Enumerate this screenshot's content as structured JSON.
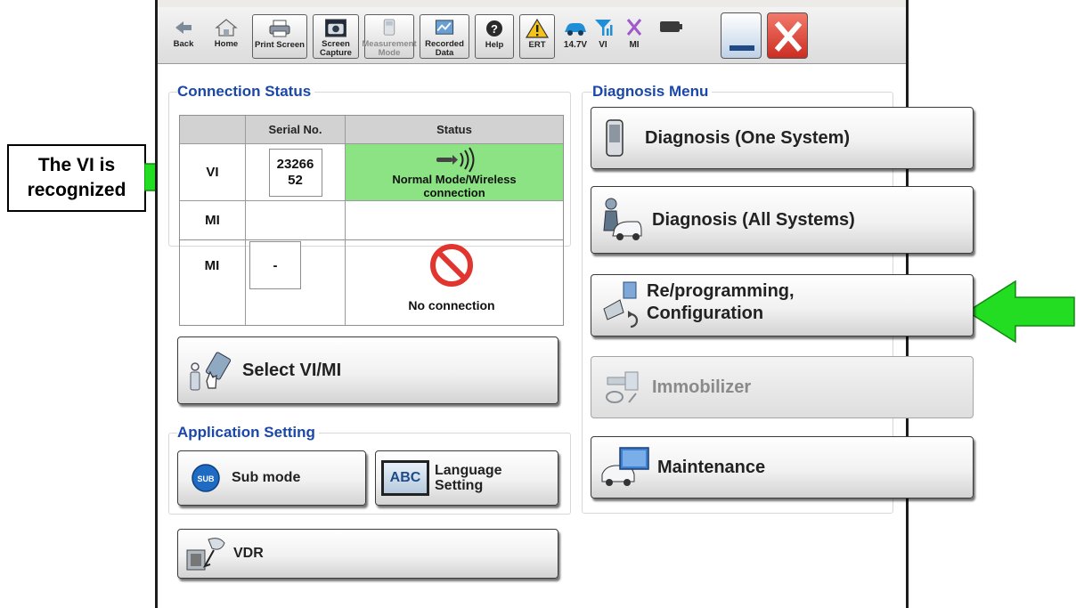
{
  "toolbar": {
    "back_label": "Back",
    "home_label": "Home",
    "print_screen_label": "Print Screen",
    "screen_capture_label": "Screen Capture",
    "measurement_mode_label": "Measurement Mode",
    "recorded_data_label": "Recorded Data",
    "help_label": "Help",
    "ert_label": "ERT",
    "battery_voltage": "14.7V",
    "vi_label": "VI",
    "mi_label": "MI"
  },
  "connection_status": {
    "title": "Connection Status",
    "columns": [
      "Serial No.",
      "Status"
    ],
    "rows": [
      {
        "device": "VI",
        "serial": "2326652",
        "status": "Normal Mode/Wireless connection"
      },
      {
        "device": "MI",
        "serial": "-",
        "status": "No connection"
      }
    ]
  },
  "select_vi_mi_label": "Select VI/MI",
  "application_setting": {
    "title": "Application Setting",
    "sub_mode_label": "Sub mode",
    "sub_badge": "SUB",
    "language_setting_label": "Language Setting",
    "abc_badge": "ABC"
  },
  "vdr_label": "VDR",
  "diagnosis_menu": {
    "title": "Diagnosis Menu",
    "one_system_label": "Diagnosis (One System)",
    "all_systems_label": "Diagnosis (All Systems)",
    "reprogramming_label_line1": "Re/programming,",
    "reprogramming_label_line2": "Configuration",
    "immobilizer_label": "Immobilizer",
    "maintenance_label": "Maintenance"
  },
  "annotation": {
    "callout_line1": "The VI is",
    "callout_line2": "recognized",
    "arrow_color": "#22dd22"
  },
  "colors": {
    "section_title": "#1a47a8",
    "status_ok": "#8be383",
    "no_connection": "#e0362f",
    "close_button": "#e0362f"
  }
}
